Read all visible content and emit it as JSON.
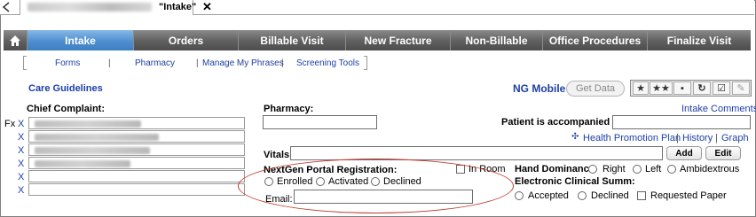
{
  "window": {
    "doc_tab_title": "\"Intake\"",
    "close_glyph": "✕"
  },
  "nav": {
    "tabs": [
      "Intake",
      "Orders",
      "Billable Visit",
      "New Fracture",
      "Non-Billable",
      "Office Procedures",
      "Finalize Visit"
    ],
    "active": "Intake"
  },
  "sublinks": {
    "forms": "Forms",
    "sep1": "|",
    "pharmacy": "Pharmacy",
    "sep2": "|",
    "manage": "Manage My Phrases",
    "sep3": "|",
    "screening": "Screening Tools"
  },
  "care_guidelines": "Care Guidelines",
  "ng_mobile": "NG Mobile",
  "get_data": "Get Data",
  "toolbar_icons": [
    "star-icon",
    "multi-star-icon",
    "save-icon",
    "refresh-icon",
    "checklist-icon",
    "eraser-icon"
  ],
  "chief_complaint": {
    "label": "Chief Complaint:",
    "fx": "Fx",
    "x": "X"
  },
  "pharmacy": {
    "label": "Pharmacy:"
  },
  "accompanied": {
    "label": "Patient is accompanied by:"
  },
  "intake_comments": "Intake Comments",
  "health": {
    "promo": "Health Promotion Plan",
    "sep1": "|",
    "history": "History",
    "sep2": "|",
    "graph": "Graph"
  },
  "vitals": {
    "label": "Vitals:",
    "add": "Add",
    "edit": "Edit"
  },
  "portal": {
    "label": "NextGen Portal Registration:",
    "in_room": "In Room",
    "enrolled": "Enrolled",
    "activated": "Activated",
    "declined": "Declined",
    "email_label": "Email:"
  },
  "hand": {
    "label": "Hand Dominance",
    "right": "Right",
    "left": "Left",
    "ambi": "Ambidextrous"
  },
  "ecs": {
    "label": "Electronic Clinical Summ:",
    "accepted": "Accepted",
    "declined": "Declined",
    "requested": "Requested Paper"
  }
}
